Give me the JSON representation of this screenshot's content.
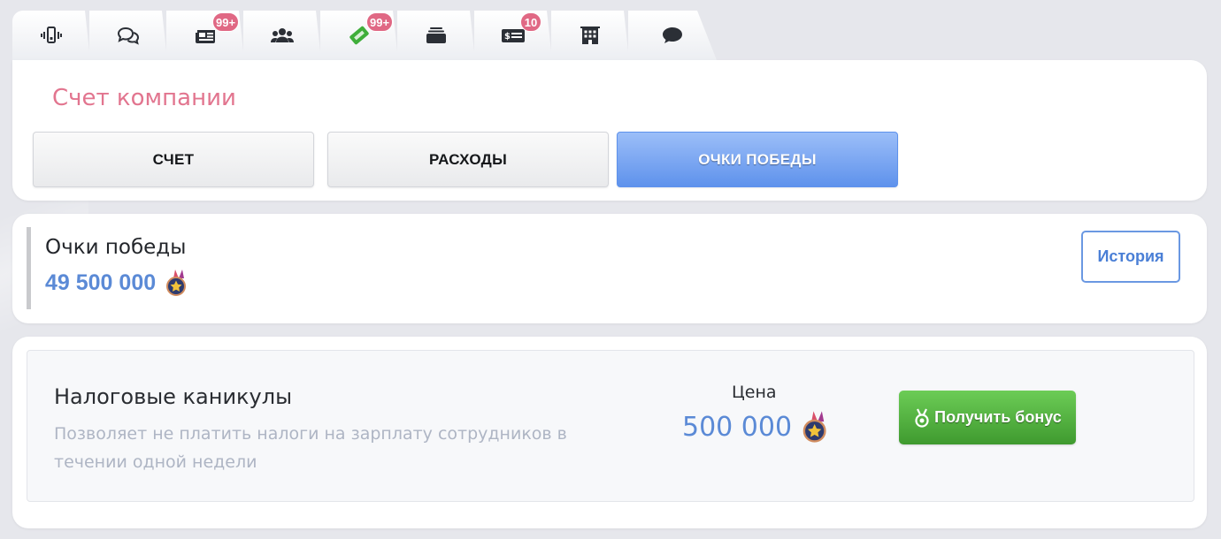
{
  "tabs": [
    {
      "icon": "phone-vibrate-icon",
      "badge": ""
    },
    {
      "icon": "chat-bubbles-icon",
      "badge": ""
    },
    {
      "icon": "newspaper-icon",
      "badge": "99+"
    },
    {
      "icon": "users-group-icon",
      "badge": ""
    },
    {
      "icon": "ticket-icon",
      "badge": "99+"
    },
    {
      "icon": "layers-icon",
      "badge": ""
    },
    {
      "icon": "check-money-icon",
      "badge": "10"
    },
    {
      "icon": "building-icon",
      "badge": ""
    },
    {
      "icon": "comment-icon",
      "badge": ""
    }
  ],
  "header": {
    "title": "Счет компании",
    "buttons": [
      "СЧЕТ",
      "РАСХОДЫ",
      "ОЧКИ ПОБЕДЫ"
    ],
    "active_index": 2
  },
  "points": {
    "label": "Очки победы",
    "value": "49 500 000",
    "history_label": "История"
  },
  "bonus": {
    "title": "Налоговые каникулы",
    "description": "Позволяет не платить налоги на зарплату сотрудников в течении одной недели",
    "price_label": "Цена",
    "price_value": "500 000",
    "button_label": "Получить бонус"
  },
  "colors": {
    "accent_blue": "#5e92ec",
    "title_pink": "#e2758f",
    "badge_pink": "#e06884",
    "button_green": "#4fae3a"
  }
}
